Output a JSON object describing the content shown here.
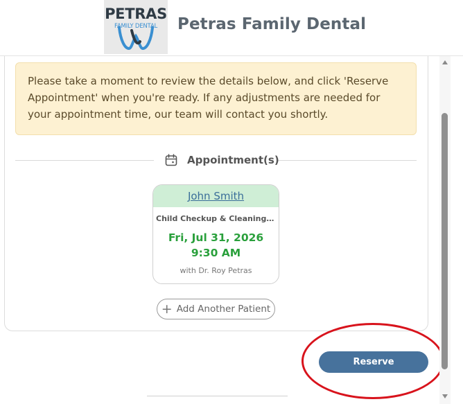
{
  "header": {
    "logo_word": "PETRAS",
    "logo_sub": "FAMILY DENTAL",
    "brand_name": "Petras Family Dental"
  },
  "notice": {
    "text": "Please take a moment to review the details below, and click 'Reserve Appointment' when you're ready. If any adjustments are needed for your appointment time, our team will contact you shortly."
  },
  "appointments": {
    "heading": "Appointment(s)",
    "items": [
      {
        "patient": "John Smith",
        "service": "Child Checkup & Cleaning (A...",
        "date": "Fri, Jul 31, 2026",
        "time": "9:30 AM",
        "doctor": "with Dr. Roy Petras"
      }
    ]
  },
  "actions": {
    "add_patient_label": "Add Another Patient",
    "reserve_label": "Reserve Appointment"
  },
  "colors": {
    "accent": "#47729c",
    "notice_bg": "#fdf1d2",
    "patient_bar": "#cfeed6",
    "date_green": "#2aa03c",
    "highlight": "#d8131c"
  }
}
